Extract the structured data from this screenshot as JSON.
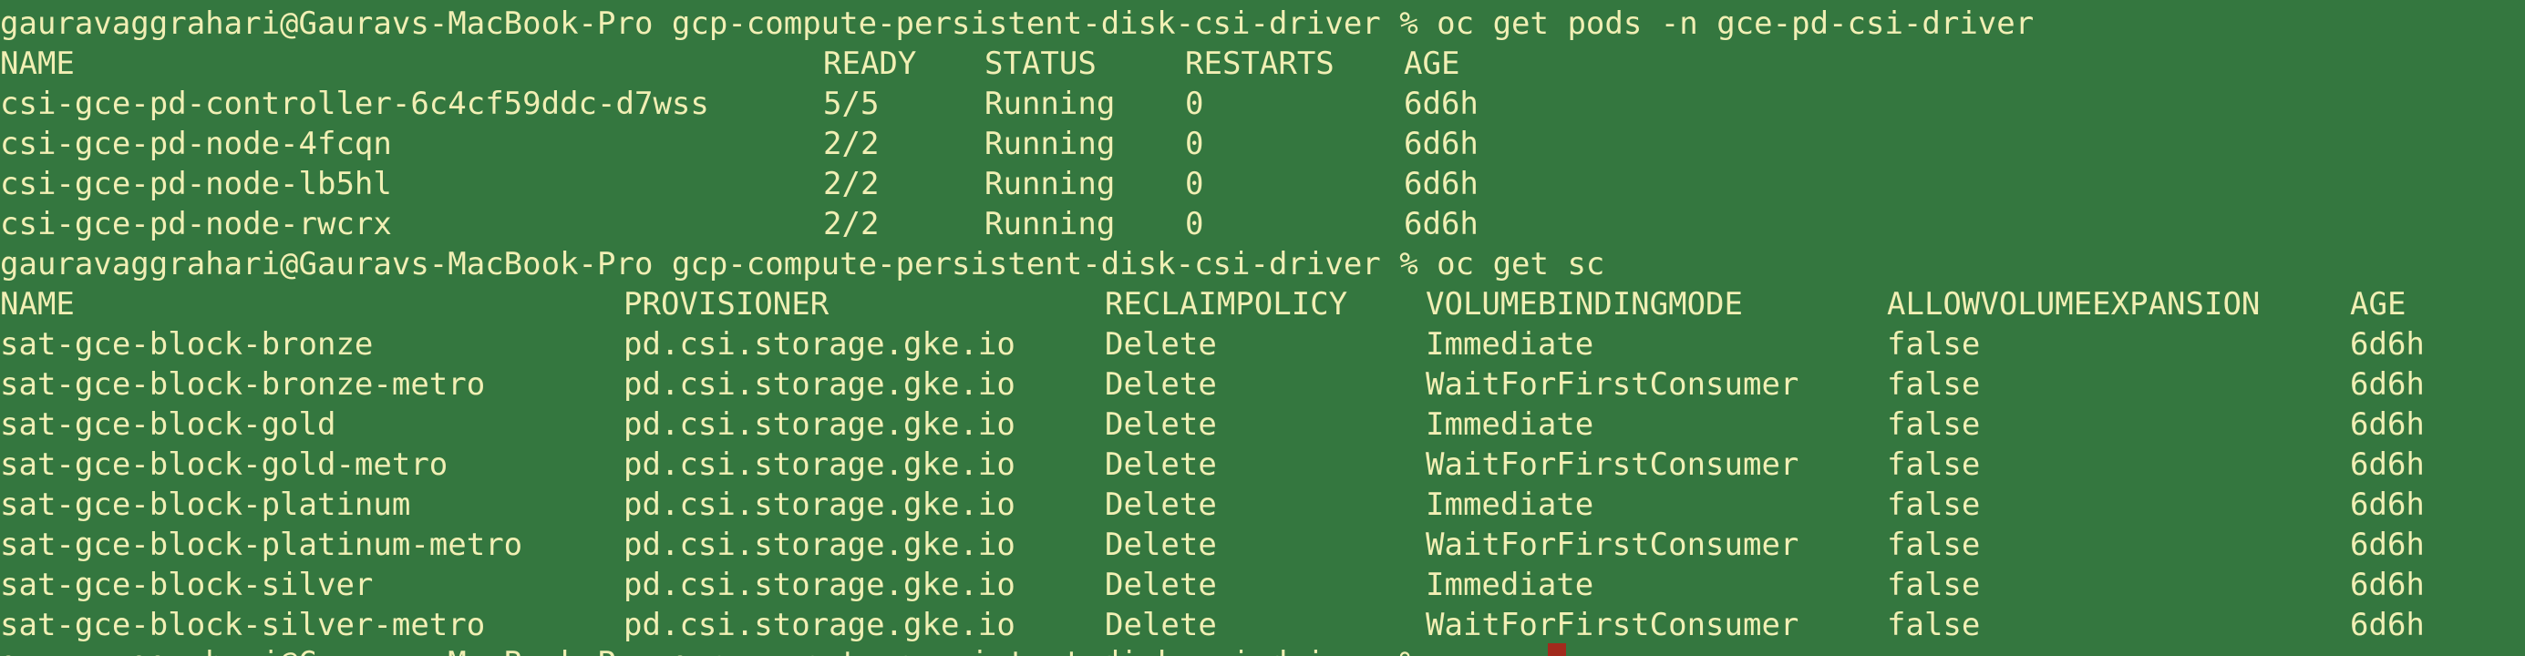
{
  "prompts": {
    "pods": "gauravaggrahari@Gauravs-MacBook-Pro gcp-compute-persistent-disk-csi-driver % oc get pods -n gce-pd-csi-driver",
    "sc": "gauravaggrahari@Gauravs-MacBook-Pro gcp-compute-persistent-disk-csi-driver % oc get sc",
    "next": "gauravaggrahari@Gauravs-MacBook-Pro gcp-compute-persistent-disk-csi-driver % "
  },
  "pods_table": {
    "headers": [
      "NAME",
      "READY",
      "STATUS",
      "RESTARTS",
      "AGE"
    ],
    "rows": [
      [
        "csi-gce-pd-controller-6c4cf59ddc-d7wss",
        "5/5",
        "Running",
        "0",
        "6d6h"
      ],
      [
        "csi-gce-pd-node-4fcqn",
        "2/2",
        "Running",
        "0",
        "6d6h"
      ],
      [
        "csi-gce-pd-node-lb5hl",
        "2/2",
        "Running",
        "0",
        "6d6h"
      ],
      [
        "csi-gce-pd-node-rwcrx",
        "2/2",
        "Running",
        "0",
        "6d6h"
      ]
    ]
  },
  "sc_table": {
    "headers": [
      "NAME",
      "PROVISIONER",
      "RECLAIMPOLICY",
      "VOLUMEBINDINGMODE",
      "ALLOWVOLUMEEXPANSION",
      "AGE"
    ],
    "rows": [
      [
        "sat-gce-block-bronze",
        "pd.csi.storage.gke.io",
        "Delete",
        "Immediate",
        "false",
        "6d6h"
      ],
      [
        "sat-gce-block-bronze-metro",
        "pd.csi.storage.gke.io",
        "Delete",
        "WaitForFirstConsumer",
        "false",
        "6d6h"
      ],
      [
        "sat-gce-block-gold",
        "pd.csi.storage.gke.io",
        "Delete",
        "Immediate",
        "false",
        "6d6h"
      ],
      [
        "sat-gce-block-gold-metro",
        "pd.csi.storage.gke.io",
        "Delete",
        "WaitForFirstConsumer",
        "false",
        "6d6h"
      ],
      [
        "sat-gce-block-platinum",
        "pd.csi.storage.gke.io",
        "Delete",
        "Immediate",
        "false",
        "6d6h"
      ],
      [
        "sat-gce-block-platinum-metro",
        "pd.csi.storage.gke.io",
        "Delete",
        "WaitForFirstConsumer",
        "false",
        "6d6h"
      ],
      [
        "sat-gce-block-silver",
        "pd.csi.storage.gke.io",
        "Delete",
        "Immediate",
        "false",
        "6d6h"
      ],
      [
        "sat-gce-block-silver-metro",
        "pd.csi.storage.gke.io",
        "Delete",
        "WaitForFirstConsumer",
        "false",
        "6d6h"
      ]
    ]
  },
  "colors": {
    "background": "#34773f",
    "text": "#f1efb4",
    "cursor": "#a22a1d"
  }
}
